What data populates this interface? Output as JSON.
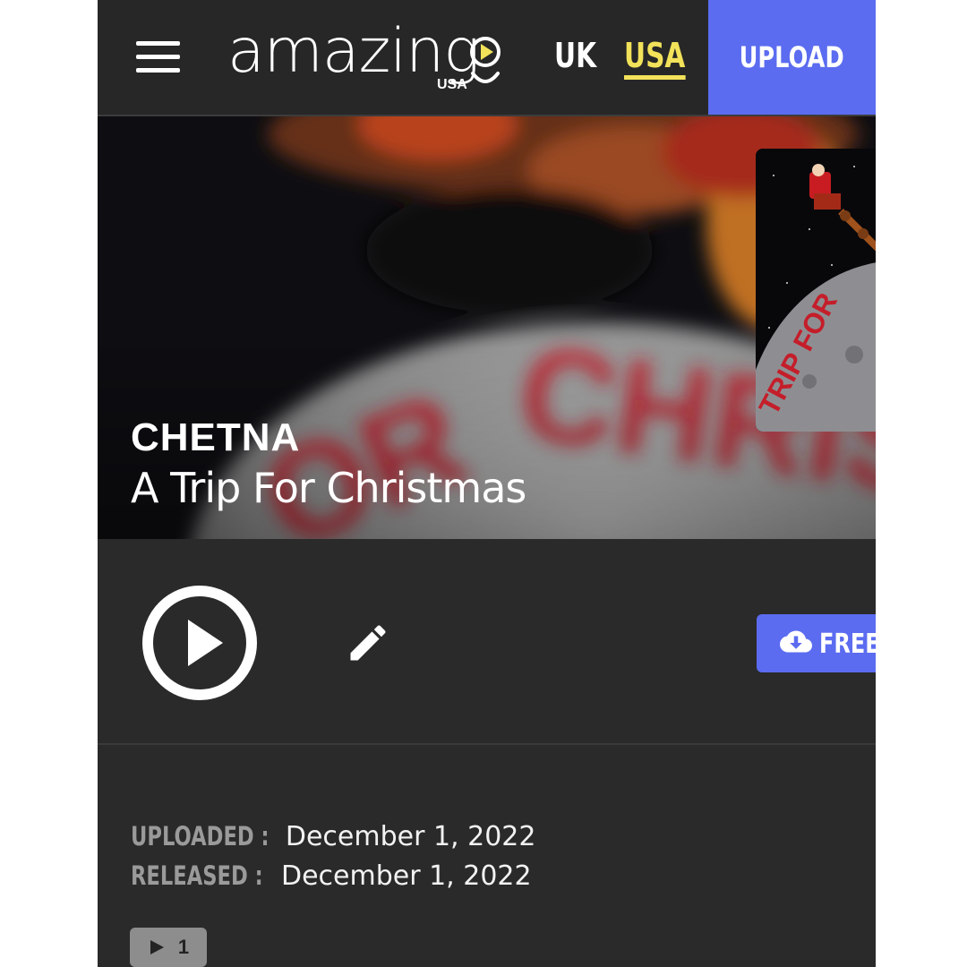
{
  "header": {
    "logo_text": "amazing",
    "logo_region": "USA",
    "nav": [
      {
        "label": "UK",
        "active": false
      },
      {
        "label": "USA",
        "active": true
      }
    ],
    "upload_label": "UPLOAD",
    "menu_icon": "hamburger-menu-icon"
  },
  "hero": {
    "artist": "CHETNA",
    "title": "A Trip For Christmas",
    "cover_art_text": "TRIP FOR"
  },
  "controls": {
    "play_icon": "play-circle-icon",
    "edit_icon": "pencil-icon",
    "download_icon": "cloud-download-icon",
    "download_label": "FREE D"
  },
  "meta": {
    "uploaded_label": "UPLOADED :",
    "uploaded_value": "December 1, 2022",
    "released_label": "RELEASED :",
    "released_value": "December 1, 2022",
    "plays_count": "1"
  },
  "colors": {
    "accent": "#5b6cf0",
    "active_nav": "#f2e25a",
    "background": "#2a2a2a",
    "header": "#272727"
  }
}
